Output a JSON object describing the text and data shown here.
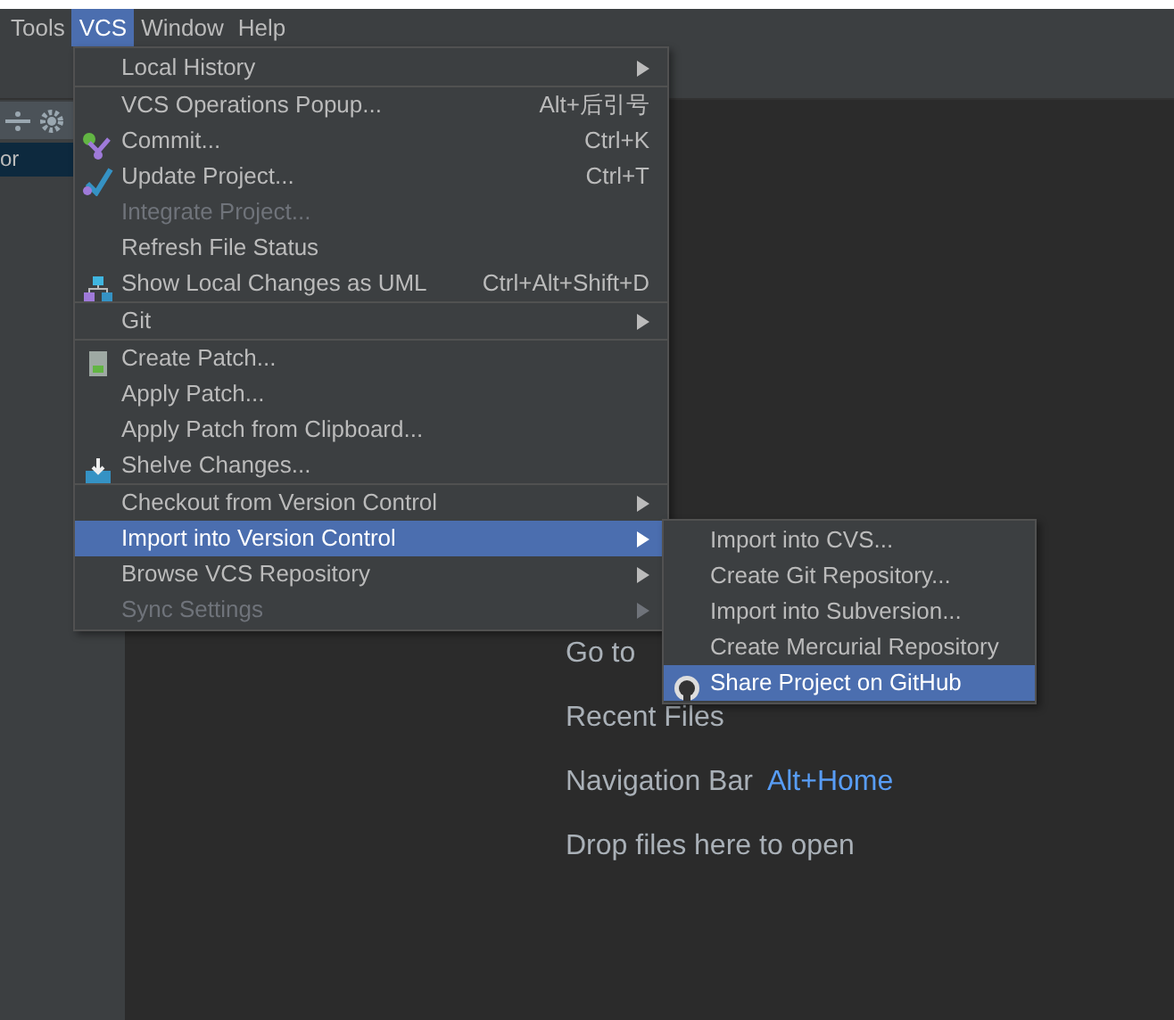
{
  "menubar": [
    {
      "label": "Tools",
      "selected": false
    },
    {
      "label": "VCS",
      "selected": true
    },
    {
      "label": "Window",
      "selected": false
    },
    {
      "label": "Help",
      "selected": false
    }
  ],
  "side_panel": {
    "item": "or"
  },
  "vcs_menu": [
    {
      "kind": "item",
      "label": "Local History",
      "submenu": true,
      "disabled": false,
      "selected": false
    },
    {
      "kind": "separator"
    },
    {
      "kind": "item",
      "label": "VCS Operations Popup...",
      "shortcut": "Alt+后引号",
      "disabled": false,
      "selected": false
    },
    {
      "kind": "item",
      "label": "Commit...",
      "shortcut": "Ctrl+K",
      "disabled": false,
      "selected": false
    },
    {
      "kind": "item",
      "label": "Update Project...",
      "shortcut": "Ctrl+T",
      "disabled": false,
      "selected": false
    },
    {
      "kind": "item",
      "label": "Integrate Project...",
      "disabled": true,
      "selected": false
    },
    {
      "kind": "item",
      "label": "Refresh File Status",
      "disabled": false,
      "selected": false
    },
    {
      "kind": "item",
      "label": "Show Local Changes as UML",
      "shortcut": "Ctrl+Alt+Shift+D",
      "disabled": false,
      "selected": false
    },
    {
      "kind": "separator"
    },
    {
      "kind": "item",
      "label": "Git",
      "submenu": true,
      "disabled": false,
      "selected": false
    },
    {
      "kind": "separator"
    },
    {
      "kind": "item",
      "label": "Create Patch...",
      "disabled": false,
      "selected": false
    },
    {
      "kind": "item",
      "label": "Apply Patch...",
      "disabled": false,
      "selected": false
    },
    {
      "kind": "item",
      "label": "Apply Patch from Clipboard...",
      "disabled": false,
      "selected": false
    },
    {
      "kind": "item",
      "label": "Shelve Changes...",
      "disabled": false,
      "selected": false
    },
    {
      "kind": "separator"
    },
    {
      "kind": "item",
      "label": "Checkout from Version Control",
      "submenu": true,
      "disabled": false,
      "selected": false
    },
    {
      "kind": "item",
      "label": "Import into Version Control",
      "submenu": true,
      "disabled": false,
      "selected": true
    },
    {
      "kind": "item",
      "label": "Browse VCS Repository",
      "submenu": true,
      "disabled": false,
      "selected": false
    },
    {
      "kind": "item",
      "label": "Sync Settings",
      "submenu": true,
      "disabled": true,
      "selected": false
    }
  ],
  "import_submenu": [
    {
      "label": "Import into CVS...",
      "selected": false
    },
    {
      "label": "Create Git Repository...",
      "selected": false
    },
    {
      "label": "Import into Subversion...",
      "selected": false
    },
    {
      "label": "Create Mercurial Repository",
      "selected": false
    },
    {
      "label": "Share Project on GitHub",
      "selected": true
    }
  ],
  "editor_hints": [
    {
      "text": "Go to"
    },
    {
      "text": "Recent Files"
    },
    {
      "text": "Navigation Bar",
      "shortcut": "Alt+Home"
    },
    {
      "text": "Drop files here to open"
    }
  ]
}
